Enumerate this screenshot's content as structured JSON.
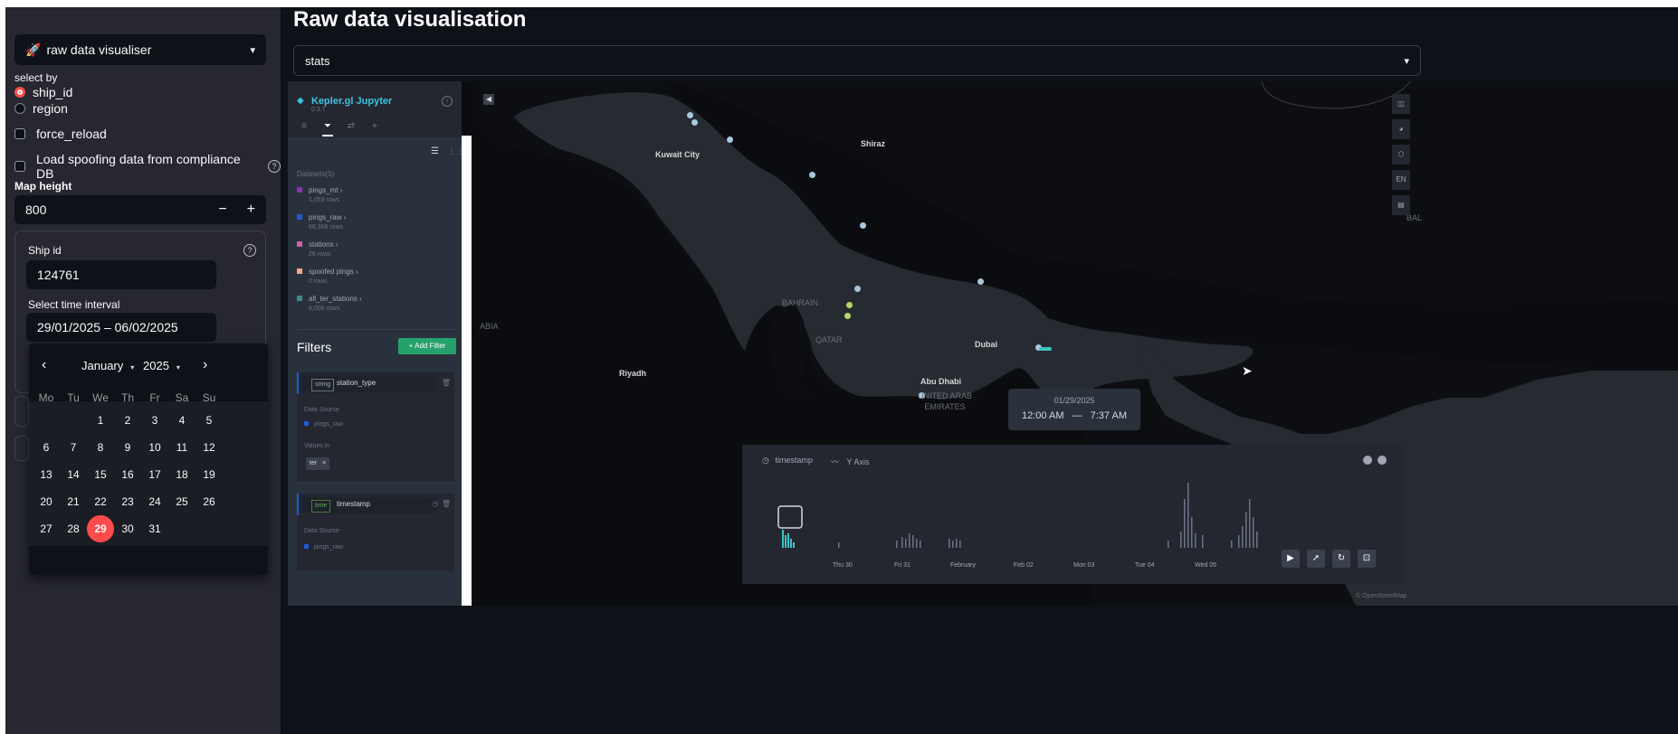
{
  "sidebar": {
    "page_select": {
      "emoji": "🚀",
      "label": "raw data visualiser"
    },
    "select_by_label": "select by",
    "radio_options": [
      {
        "label": "ship_id",
        "selected": true
      },
      {
        "label": "region",
        "selected": false
      }
    ],
    "force_reload_label": "force_reload",
    "spoofing_label": "Load spoofing data from compliance DB",
    "map_height": {
      "label": "Map height",
      "value": "800",
      "minus": "−",
      "plus": "+"
    },
    "ship_id": {
      "label": "Ship id",
      "value": "124761"
    },
    "time_interval": {
      "label": "Select time interval",
      "value": "29/01/2025 – 06/02/2025"
    },
    "calendar": {
      "month": "January",
      "year": "2025",
      "prev": "‹",
      "next": "›",
      "weekdays": [
        "Mo",
        "Tu",
        "We",
        "Th",
        "Fr",
        "Sa",
        "Su"
      ],
      "days": [
        "1",
        "2",
        "3",
        "4",
        "5",
        "6",
        "7",
        "8",
        "9",
        "10",
        "11",
        "12",
        "13",
        "14",
        "15",
        "16",
        "17",
        "18",
        "19",
        "20",
        "21",
        "22",
        "23",
        "24",
        "25",
        "26",
        "27",
        "28",
        "29",
        "30",
        "31"
      ],
      "first_weekday_index": 2,
      "selected_day": "29"
    }
  },
  "main": {
    "title": "Raw data visualisation",
    "select": {
      "value": "stats"
    }
  },
  "kepler": {
    "title": "Kepler.gl Jupyter",
    "version": "0.3.7",
    "datasets_label": "Datasets(5)",
    "datasets": [
      {
        "name": "pings_mt",
        "rows": "1,053 rows",
        "color": "#8b2fb3"
      },
      {
        "name": "pings_raw",
        "rows": "68,368 rows",
        "color": "#1f5bd6"
      },
      {
        "name": "stations",
        "rows": "26 rows",
        "color": "#d063a6"
      },
      {
        "name": "spoofed pings",
        "rows": "0 rows",
        "color": "#f2a68c"
      },
      {
        "name": "all_ter_stations",
        "rows": "8,006 rows",
        "color": "#3e8a8a"
      }
    ],
    "filters_label": "Filters",
    "add_filter": "+ Add Filter",
    "filter1": {
      "type": "string",
      "field": "station_type",
      "source_label": "Data Source",
      "source": "pings_raw",
      "values_label": "Values in",
      "value": "ter"
    },
    "filter2": {
      "type": "time",
      "field": "timestamp",
      "source_label": "Data Source",
      "source": "pings_raw"
    }
  },
  "map": {
    "cities": [
      {
        "name": "Kuwait City"
      },
      {
        "name": "Shiraz"
      },
      {
        "name": "BAHRAIN"
      },
      {
        "name": "QATAR"
      },
      {
        "name": "Dubai"
      },
      {
        "name": "Abu Dhabi"
      },
      {
        "name": "UNITED ARAB EMIRATES"
      },
      {
        "name": "Riyadh"
      },
      {
        "name": "ABIA"
      },
      {
        "name": "BAL"
      }
    ],
    "language_button": "EN",
    "time_pill": {
      "date": "01/29/2025",
      "start": "12:00 AM",
      "sep": "—",
      "end": "7:37 AM"
    },
    "timeline": {
      "field": "timestamp",
      "y_axis": "Y Axis",
      "ticks": [
        "Thu 30",
        "Fri 31",
        "February",
        "Feb 02",
        "Mon 03",
        "Tue 04",
        "Wed 05"
      ]
    },
    "attribution": "© OpenStreetMap"
  }
}
